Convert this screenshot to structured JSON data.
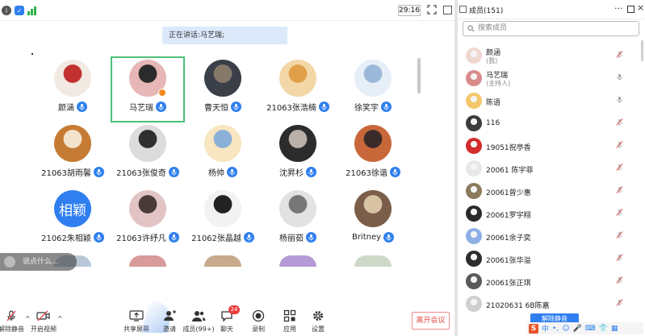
{
  "topbar": {
    "timer": "29:16"
  },
  "speaking": {
    "label": "正在讲话:",
    "speaker": "马艺瑞;"
  },
  "grid": [
    {
      "name": "颜涵",
      "active": false,
      "host": false,
      "bg": "#f2e9e2",
      "fg": "#c23030"
    },
    {
      "name": "马艺瑞",
      "active": true,
      "host": true,
      "bg": "#e7b7b7",
      "fg": "#2b2b2b"
    },
    {
      "name": "曹天恒",
      "active": false,
      "host": false,
      "bg": "#3a3f48",
      "fg": "#86796a"
    },
    {
      "name": "21063张浩楠",
      "active": false,
      "host": false,
      "bg": "#f3d7a7",
      "fg": "#e0a049"
    },
    {
      "name": "徐笑宇",
      "active": false,
      "host": false,
      "bg": "#e6eef7",
      "fg": "#9cb8d8"
    },
    {
      "name": "21063胡雨馨",
      "active": false,
      "host": false,
      "bg": "#c67b34",
      "fg": "#f3e3cc"
    },
    {
      "name": "21063张俊奇",
      "active": false,
      "host": false,
      "bg": "#dcdcdc",
      "fg": "#2f2f2f"
    },
    {
      "name": "杨帅",
      "active": false,
      "host": false,
      "bg": "#f7e6c0",
      "fg": "#8bb0d8"
    },
    {
      "name": "沈昇杉",
      "active": false,
      "host": false,
      "bg": "#2c2c2c",
      "fg": "#b9b0a9"
    },
    {
      "name": "21063徐谐",
      "active": false,
      "host": false,
      "bg": "#c8683a",
      "fg": "#3b2a2a"
    },
    {
      "name": "21062朱相颖",
      "active": false,
      "host": false,
      "bg": "#2f7ff0",
      "fg": "#2f7ff0",
      "text_avatar": "相颖"
    },
    {
      "name": "21063许纾凡",
      "active": false,
      "host": false,
      "bg": "#e3c4c4",
      "fg": "#4a3a3a"
    },
    {
      "name": "21062张晶越",
      "active": false,
      "host": false,
      "bg": "#f2f2f2",
      "fg": "#222"
    },
    {
      "name": "杨丽茹",
      "active": false,
      "host": false,
      "bg": "#e2e2e2",
      "fg": "#777"
    },
    {
      "name": "Britney",
      "active": false,
      "host": false,
      "bg": "#7a5e4a",
      "fg": "#d9c3a5"
    }
  ],
  "partial_row": [
    {
      "bg": "#b9c7d6"
    },
    {
      "bg": "#d89a9a"
    },
    {
      "bg": "#c7a98b"
    },
    {
      "bg": "#b59bd6"
    },
    {
      "bg": "#cfd9c8"
    }
  ],
  "comment_placeholder": "说点什么...",
  "toolbar": {
    "unmute_all": "解除静音",
    "start_video": "开启视频",
    "share": "共享屏幕",
    "invite": "邀请",
    "members": "成员(99+)",
    "chat": "聊天",
    "chat_badge": "24",
    "record": "录制",
    "apps": "应用",
    "settings": "设置",
    "leave": "离开会议"
  },
  "panel": {
    "title": "成员(151)",
    "search_placeholder": "搜索成员",
    "members": [
      {
        "name": "颜涵",
        "role": "(我)",
        "mic": "muted",
        "bg": "#f0d8d0"
      },
      {
        "name": "马艺瑞",
        "role": "(主持人)",
        "mic": "on",
        "bg": "#d98a8a"
      },
      {
        "name": "陈语",
        "role": "",
        "mic": "on",
        "bg": "#f3c76a"
      },
      {
        "name": "116",
        "role": "",
        "mic": "muted",
        "bg": "#3c3c3c"
      },
      {
        "name": "19051祝亭香",
        "role": "",
        "mic": "muted",
        "bg": "#d22c2c"
      },
      {
        "name": "20061 陈宇菲",
        "role": "",
        "mic": "muted",
        "bg": "#e8e8e8"
      },
      {
        "name": "20061曾少惠",
        "role": "",
        "mic": "muted",
        "bg": "#8c7a5c"
      },
      {
        "name": "20061罗宇翔",
        "role": "",
        "mic": "muted",
        "bg": "#2a2a2a"
      },
      {
        "name": "20061余子奕",
        "role": "",
        "mic": "muted",
        "bg": "#8fb0e6"
      },
      {
        "name": "20061张华溢",
        "role": "",
        "mic": "muted",
        "bg": "#2c2c2c"
      },
      {
        "name": "20061张正琪",
        "role": "",
        "mic": "muted",
        "bg": "#5a5a5a"
      },
      {
        "name": "21020631 6B陈嘉",
        "role": "",
        "mic": "muted",
        "bg": "#cfcfcf"
      }
    ],
    "unmute_all": "解除静音"
  },
  "ime": {
    "label": "中"
  },
  "colors": {
    "accent": "#2f7ff0",
    "active_border": "#4cbf7c",
    "danger": "#e24c4c"
  }
}
